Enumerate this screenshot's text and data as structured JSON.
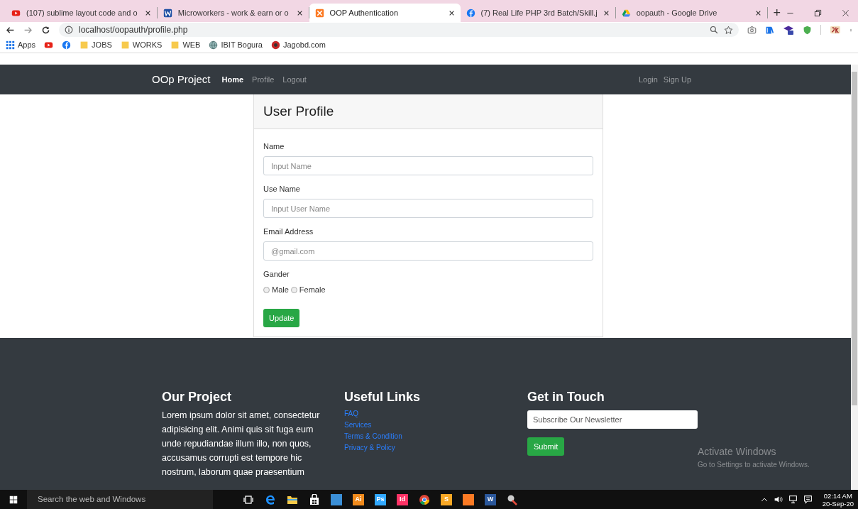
{
  "browser": {
    "tabs": [
      {
        "title": "(107) sublime layout code and o",
        "kind": "youtube",
        "selected": false
      },
      {
        "title": "Microworkers - work & earn or o",
        "kind": "microworkers",
        "selected": false
      },
      {
        "title": "OOP Authentication",
        "kind": "xampp",
        "selected": true
      },
      {
        "title": "(7) Real Life PHP 3rd Batch/Skill.j",
        "kind": "facebook",
        "selected": false
      },
      {
        "title": "oopauth - Google Drive",
        "kind": "drive",
        "selected": false
      }
    ],
    "new_tab": "+",
    "url": "localhost/oopauth/profile.php",
    "bookmarks": [
      {
        "label": "Apps",
        "kind": "apps"
      },
      {
        "kind": "youtube"
      },
      {
        "kind": "facebook"
      },
      {
        "label": "JOBS",
        "kind": "folder"
      },
      {
        "label": "WORKS",
        "kind": "folder"
      },
      {
        "label": "WEB",
        "kind": "folder"
      },
      {
        "label": "IBIT Bogura",
        "kind": "globe"
      },
      {
        "label": "Jagobd.com",
        "kind": "site"
      }
    ]
  },
  "navbar": {
    "brand": "OOp Project",
    "links": [
      {
        "label": "Home",
        "selected": true
      },
      {
        "label": "Profile",
        "selected": false
      },
      {
        "label": "Logout",
        "selected": false
      }
    ],
    "right_links": [
      "Login",
      "Sign Up"
    ]
  },
  "card": {
    "title": "User Profile",
    "fields": [
      {
        "label": "Name",
        "placeholder": "Input Name"
      },
      {
        "label": "Use Name",
        "placeholder": "Input User Name"
      },
      {
        "label": "Email Address",
        "placeholder": "@gmail.com"
      }
    ],
    "gender": {
      "label": "Gander",
      "options": [
        {
          "label": "Male",
          "checked": false
        },
        {
          "label": "Female",
          "checked": false
        }
      ]
    },
    "button": "Update"
  },
  "footer": {
    "about": {
      "title": "Our Project",
      "text": "Lorem ipsum dolor sit amet, consectetur adipisicing elit. Animi quis sit fuga eum unde repudiandae illum illo, non quos, accusamus corrupti est tempore hic nostrum, laborum quae praesentium"
    },
    "links": {
      "title": "Useful Links",
      "items": [
        "FAQ",
        "Services",
        "Terms & Condition",
        "Privacy & Policy"
      ]
    },
    "contact": {
      "title": "Get in Touch",
      "placeholder": "Subscribe Our Newsletter",
      "button": "Submit"
    }
  },
  "activation": {
    "title": "Activate Windows",
    "text": "Go to Settings to activate Windows."
  },
  "taskbar": {
    "search": "Search the web and Windows",
    "apps": [
      {
        "kind": "taskview"
      },
      {
        "kind": "edge"
      },
      {
        "kind": "folder"
      },
      {
        "kind": "store"
      },
      {
        "kind": "tile",
        "color": "#3b8fd6"
      },
      {
        "kind": "tile",
        "label": "Ai",
        "color": "#f08a1c"
      },
      {
        "kind": "tile",
        "label": "Ps",
        "color": "#31a8ff"
      },
      {
        "kind": "tile",
        "label": "Id",
        "color": "#ff3366"
      },
      {
        "kind": "chrome"
      },
      {
        "kind": "tile",
        "label": "S",
        "color": "#f9a825"
      },
      {
        "kind": "tile",
        "color": "#fb7a24"
      },
      {
        "kind": "tile",
        "label": "W",
        "color": "#2b579a"
      },
      {
        "kind": "paint"
      }
    ],
    "time": "02:14 AM",
    "date": "20-Sep-20"
  }
}
